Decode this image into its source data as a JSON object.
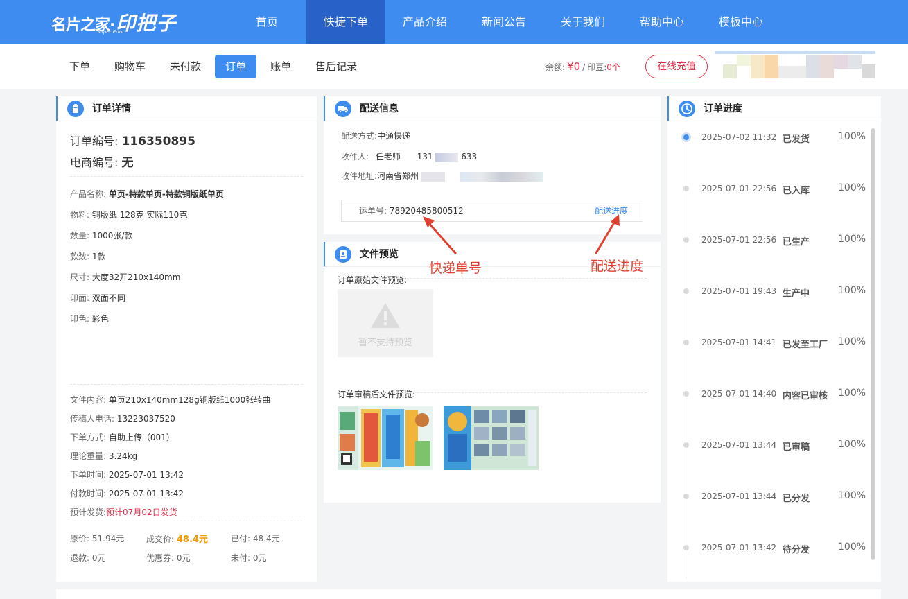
{
  "brand": {
    "logo_left": "名片之家·",
    "logo_right": "印把子",
    "logo_sub": "Super Print"
  },
  "nav": [
    "首页",
    "快捷下单",
    "产品介绍",
    "新闻公告",
    "关于我们",
    "帮助中心",
    "模板中心"
  ],
  "subnav": [
    "下单",
    "购物车",
    "未付款",
    "订单",
    "账单",
    "售后记录"
  ],
  "account": {
    "balance_label": "余额:",
    "balance_value": "¥0",
    "sep": "/",
    "beans_label": "印豆:",
    "beans_value": "0个",
    "recharge": "在线充值"
  },
  "order": {
    "title": "订单详情",
    "number_label": "订单编号:",
    "number": "116350895",
    "ecom_label": "电商编号:",
    "ecom": "无",
    "product_label": "产品名称:",
    "product": "单页-特款单页-特款铜版纸单页",
    "material_label": "物料:",
    "material": "铜版纸 128克 实际110克",
    "qty_label": "数量:",
    "qty": "1000张/款",
    "kinds_label": "款数:",
    "kinds": "1款",
    "size_label": "尺寸:",
    "size": "大度32开210x140mm",
    "side_label": "印面:",
    "side": "双面不同",
    "color_label": "印色:",
    "color": "彩色",
    "content_label": "文件内容:",
    "content": "单页210x140mm128g铜版纸1000张转曲",
    "phone_label": "传稿人电话:",
    "phone": "13223037520",
    "method_label": "下单方式:",
    "method": "自助上传（001）",
    "weight_label": "理论重量:",
    "weight": "3.24kg",
    "order_time_label": "下单时间:",
    "order_time": "2025-07-01 13:42",
    "pay_time_label": "付款时间:",
    "pay_time": "2025-07-01 13:42",
    "ship_label": "预计发货:",
    "ship": "预计07月02日发货",
    "original_label": "原价:",
    "original": "51.94元",
    "deal_label": "成交价:",
    "deal": "48.4元",
    "paid_label": "已付:",
    "paid": "48.4元",
    "refund_label": "退款:",
    "refund": "0元",
    "coupon_label": "优惠券:",
    "coupon": "0元",
    "unpaid_label": "未付:",
    "unpaid": "0元"
  },
  "delivery": {
    "title": "配送信息",
    "method_label": "配送方式:",
    "method": "中通快递",
    "receiver_label": "收件人:",
    "receiver": "任老师",
    "phone_start": "131",
    "phone_end": "633",
    "address_label": "收件地址:",
    "address": "河南省郑州",
    "tracking_label": "运单号:",
    "tracking": "78920485800512",
    "tracking_link": "配送进度"
  },
  "annotations": {
    "tracking_no": "快递单号",
    "delivery_progress": "配送进度"
  },
  "preview": {
    "title": "文件预览",
    "original_label": "订单原始文件预览:",
    "no_preview": "暂不支持预览",
    "reviewed_label": "订单审稿后文件预览:"
  },
  "progress": {
    "title": "订单进度",
    "items": [
      {
        "time": "2025-07-02 11:32",
        "status": "已发货",
        "pct": "100%"
      },
      {
        "time": "2025-07-01 22:56",
        "status": "已入库",
        "pct": "100%"
      },
      {
        "time": "2025-07-01 22:56",
        "status": "已生产",
        "pct": "100%"
      },
      {
        "time": "2025-07-01 19:43",
        "status": "生产中",
        "pct": "100%"
      },
      {
        "time": "2025-07-01 14:41",
        "status": "已发至工厂",
        "pct": "100%"
      },
      {
        "time": "2025-07-01 14:40",
        "status": "内容已审核",
        "pct": "100%"
      },
      {
        "time": "2025-07-01 13:44",
        "status": "已审稿",
        "pct": "100%"
      },
      {
        "time": "2025-07-01 13:44",
        "status": "已分发",
        "pct": "100%"
      },
      {
        "time": "2025-07-01 13:42",
        "status": "待分发",
        "pct": "100%"
      }
    ]
  },
  "colors": {
    "primary": "#3f8cf0",
    "nav_active": "#2862c9",
    "accent_red": "#e0304a",
    "orange": "#f39800",
    "annotation": "#e0402f"
  }
}
